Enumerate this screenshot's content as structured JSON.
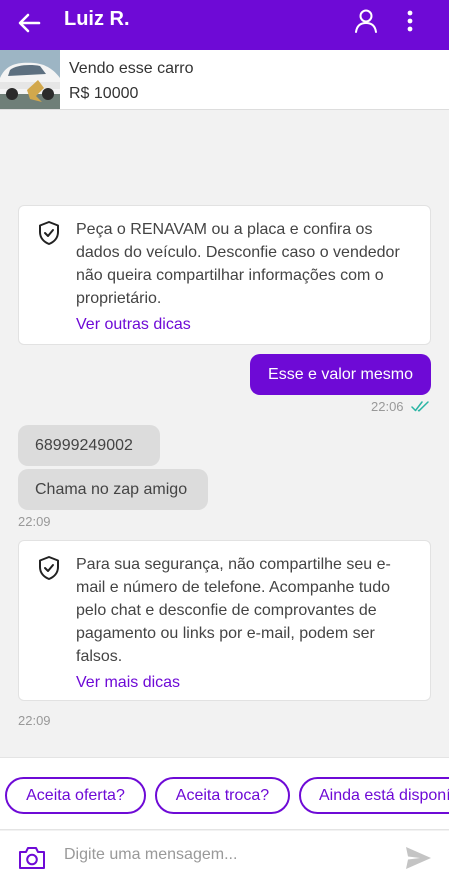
{
  "header": {
    "title": "Luiz R.",
    "icons": {
      "back": "arrow-left-icon",
      "profile": "user-icon",
      "menu": "more-vertical-icon"
    }
  },
  "product": {
    "name": "Vendo esse carro",
    "price": "R$ 10000"
  },
  "messages": {
    "tip1": {
      "text": "Peça o RENAVAM ou a placa e confira os dados do veículo. Desconfie caso o vendedor não queira compartilhar informações com o proprietário.",
      "link": "Ver outras dicas"
    },
    "outgoing": {
      "text": "Esse e valor mesmo",
      "time": "22:06"
    },
    "incoming1": {
      "text": "68999249002"
    },
    "incoming2": {
      "text": "Chama no zap amigo"
    },
    "incoming_time": "22:09",
    "tip2": {
      "text": "Para sua segurança, não compartilhe seu e-mail e número de telefone. Acompanhe tudo pelo chat e desconfie de comprovantes de pagamento ou links por e-mail, podem ser falsos.",
      "link": "Ver mais dicas"
    },
    "tip2_time": "22:09"
  },
  "quick_replies": [
    "Aceita oferta?",
    "Aceita troca?",
    "Ainda está disponível?"
  ],
  "composer": {
    "placeholder": "Digite uma mensagem..."
  },
  "colors": {
    "accent": "#6e0ad6",
    "background": "#f2f2f2",
    "incoming_bubble": "#dcdcdc",
    "read_ticks": "#2ab5a4"
  }
}
